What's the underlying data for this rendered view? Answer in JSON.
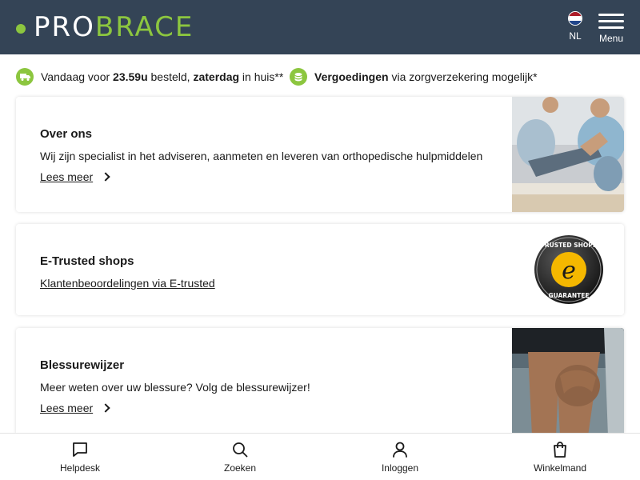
{
  "header": {
    "logo_left": "PRO",
    "logo_right": "BRACE",
    "language": "NL",
    "menu_label": "Menu",
    "colors": {
      "background": "#344456",
      "accent": "#8cc63f"
    }
  },
  "usp": {
    "delivery": {
      "icon": "truck-icon",
      "prefix": "Vandaag voor ",
      "time": "23.59u",
      "mid": " besteld, ",
      "day": "zaterdag",
      "suffix": " in huis**"
    },
    "reimburse": {
      "icon": "coins-icon",
      "strong": "Vergoedingen",
      "rest": " via zorgverzekering mogelijk*"
    }
  },
  "cards": [
    {
      "title": "Over ons",
      "description": "Wij zijn specialist in het adviseren, aanmeten en leveren van orthopedische hulpmiddelen",
      "link": "Lees meer",
      "image": "physiotherapy-photo"
    },
    {
      "title": "E-Trusted shops",
      "link": "Klantenbeoordelingen via E-trusted",
      "badge_top": "TRUSTED SHOPS",
      "badge_mid": "e",
      "badge_bottom": "GUARANTEE"
    },
    {
      "title": "Blessurewijzer",
      "description": "Meer weten over uw blessure? Volg de blessurewijzer!",
      "link": "Lees meer",
      "image": "knee-injury-photo"
    }
  ],
  "bottom_nav": [
    {
      "label": "Helpdesk",
      "icon": "chat-icon"
    },
    {
      "label": "Zoeken",
      "icon": "search-icon"
    },
    {
      "label": "Inloggen",
      "icon": "user-icon"
    },
    {
      "label": "Winkelmand",
      "icon": "shopping-bag-icon"
    }
  ]
}
